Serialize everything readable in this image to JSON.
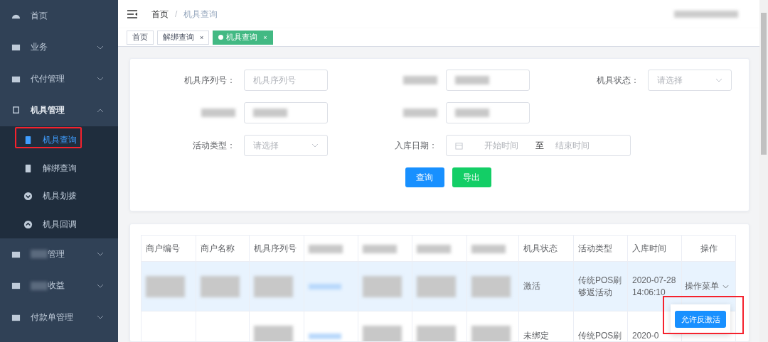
{
  "sidebar": {
    "items": [
      {
        "label": "首页"
      },
      {
        "label": "业务",
        "expanded": false
      },
      {
        "label": "代付管理",
        "expanded": false
      },
      {
        "label": "机具管理",
        "expanded": true,
        "children": [
          {
            "label": "机具查询",
            "selected": true
          },
          {
            "label": "解绑查询",
            "selected": false
          },
          {
            "label": "机具划拨",
            "selected": false
          },
          {
            "label": "机具回调",
            "selected": false
          }
        ]
      },
      {
        "label": "管理",
        "label_partly_hidden": true,
        "expanded": false
      },
      {
        "label": "收益",
        "label_partly_hidden": true,
        "expanded": false
      },
      {
        "label": "付款单管理",
        "expanded": false
      }
    ]
  },
  "breadcrumb": [
    {
      "label": "首页",
      "current": false
    },
    {
      "label": "机具查询",
      "current": true
    }
  ],
  "breadcrumb_separator": "/",
  "tabs": [
    {
      "label": "首页",
      "closable": false,
      "selected": false
    },
    {
      "label": "解绑查询",
      "closable": true,
      "selected": false
    },
    {
      "label": "机具查询",
      "closable": true,
      "selected": true
    }
  ],
  "tab_close": "×",
  "filters": [
    {
      "label": "机具序列号：",
      "kind": "text",
      "placeholder": "机具序列号"
    },
    {
      "kind": "blurred"
    },
    {
      "label": "机具状态：",
      "kind": "select",
      "placeholder": "请选择"
    },
    {
      "kind": "blurred"
    },
    {
      "kind": "blurred"
    },
    {
      "kind": "gap"
    },
    {
      "label": "活动类型：",
      "kind": "select",
      "placeholder": "请选择"
    },
    {
      "label": "入库日期：",
      "kind": "date_range",
      "start_placeholder": "开始时间",
      "separator": "至",
      "end_placeholder": "结束时间"
    }
  ],
  "buttons": [
    {
      "label": "查询",
      "kind": "primary"
    },
    {
      "label": "导出",
      "kind": "success"
    }
  ],
  "table": {
    "columns": [
      {
        "label": "商户编号"
      },
      {
        "label": "商户名称"
      },
      {
        "label": "机具序列号"
      },
      {
        "kind": "blurred"
      },
      {
        "kind": "blurred"
      },
      {
        "kind": "blurred"
      },
      {
        "kind": "blurred"
      },
      {
        "label": "机具状态"
      },
      {
        "label": "活动类型"
      },
      {
        "label": "入库时间"
      },
      {
        "label": "操作"
      }
    ],
    "rows": [
      {
        "selected": true,
        "cells": [
          {
            "kind": "blurred"
          },
          {
            "kind": "blurred"
          },
          {
            "kind": "blurred"
          },
          {
            "kind": "blurred_link"
          },
          {
            "kind": "blurred"
          },
          {
            "kind": "blurred"
          },
          {
            "kind": "blurred"
          },
          {
            "kind": "text",
            "text": "激活"
          },
          {
            "kind": "text",
            "text": "传统POS刷够返活动"
          },
          {
            "kind": "text",
            "text": "2020-07-28 14:06:10"
          },
          {
            "kind": "menu",
            "text": "操作菜单"
          }
        ]
      },
      {
        "selected": false,
        "cells": [
          {
            "kind": "empty"
          },
          {
            "kind": "empty"
          },
          {
            "kind": "blurred"
          },
          {
            "kind": "blurred_link"
          },
          {
            "kind": "blurred"
          },
          {
            "kind": "blurred"
          },
          {
            "kind": "blurred"
          },
          {
            "kind": "text",
            "text": "未绑定"
          },
          {
            "kind": "text",
            "text": "传统POS刷"
          },
          {
            "kind": "text",
            "text": "2020-0"
          },
          {
            "kind": "empty"
          }
        ]
      }
    ]
  },
  "popup_menu": {
    "items": [
      "允许反激活"
    ]
  }
}
